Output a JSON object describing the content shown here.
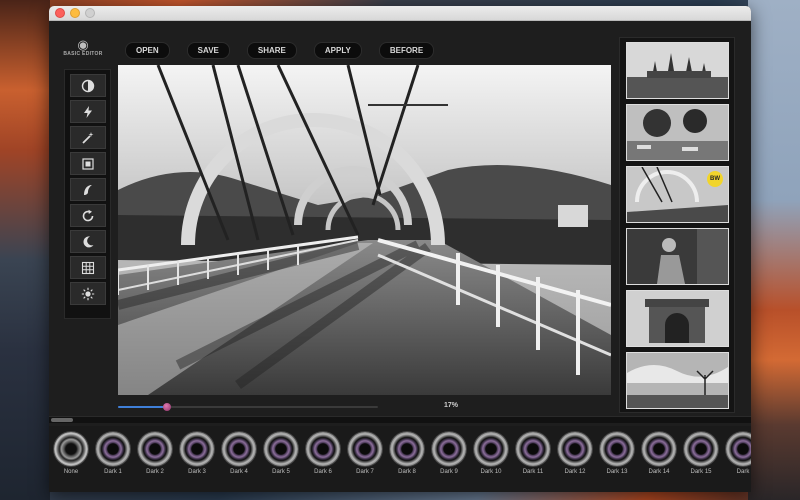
{
  "toolbar": {
    "brand_label": "BASIC EDITOR",
    "open": "OPEN",
    "save": "SAVE",
    "share": "SHARE",
    "apply": "APPLY",
    "before": "BEFORE"
  },
  "tools": [
    {
      "icon": "contrast-icon"
    },
    {
      "icon": "lightning-icon"
    },
    {
      "icon": "magic-wand-icon"
    },
    {
      "icon": "crop-icon"
    },
    {
      "icon": "effects-icon"
    },
    {
      "icon": "rotate-icon"
    },
    {
      "icon": "moon-icon"
    },
    {
      "icon": "grid-icon"
    },
    {
      "icon": "brightness-icon"
    }
  ],
  "slider": {
    "value": 0.17,
    "label": "17%"
  },
  "presets_badge": "BW",
  "filters": [
    {
      "label": "None"
    },
    {
      "label": "Dark 1"
    },
    {
      "label": "Dark 2"
    },
    {
      "label": "Dark 3"
    },
    {
      "label": "Dark 4"
    },
    {
      "label": "Dark 5"
    },
    {
      "label": "Dark 6"
    },
    {
      "label": "Dark 7"
    },
    {
      "label": "Dark 8"
    },
    {
      "label": "Dark 9"
    },
    {
      "label": "Dark 10"
    },
    {
      "label": "Dark 11"
    },
    {
      "label": "Dark 12"
    },
    {
      "label": "Dark 13"
    },
    {
      "label": "Dark 14"
    },
    {
      "label": "Dark 15"
    },
    {
      "label": "Dark"
    }
  ],
  "colors": {
    "slider_fill": "#3f7fd8",
    "badge": "#f1d52b"
  }
}
